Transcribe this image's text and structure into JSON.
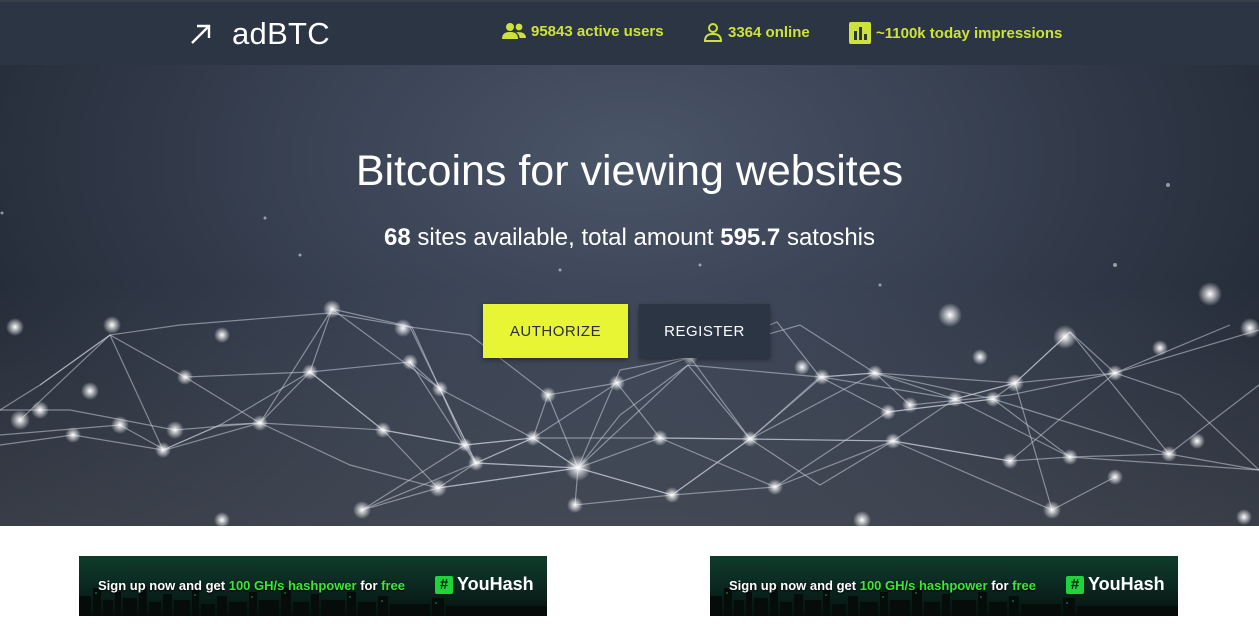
{
  "header": {
    "logo_text": "adBTC",
    "stats": {
      "active_users": "95843 active users",
      "online": "3364 online",
      "impressions": "~1100k today impressions"
    }
  },
  "hero": {
    "title": "Bitcoins for viewing websites",
    "sub_sites_count": "68",
    "sub_middle": " sites available, total amount ",
    "sub_amount": "595.7",
    "sub_unit": " satoshis",
    "authorize_label": "AUTHORIZE",
    "register_label": "REGISTER"
  },
  "banners": [
    {
      "text_part1": "Sign up now and get ",
      "text_highlight1": "100 GH/s hashpower",
      "text_part2": " for ",
      "text_highlight2": "free",
      "brand": "YouHash",
      "brand_symbol": "#"
    },
    {
      "text_part1": "Sign up now and get ",
      "text_highlight1": "100 GH/s hashpower",
      "text_part2": " for ",
      "text_highlight2": "free",
      "brand": "YouHash",
      "brand_symbol": "#"
    }
  ],
  "colors": {
    "header_bg": "#2c3544",
    "accent_yellow": "#e8f534",
    "stat_text": "#cde23a",
    "banner_green": "#3ee63a"
  },
  "icons": {
    "logo": "arrow-up-right-icon",
    "users": "users-group-icon",
    "online": "person-icon",
    "impressions": "bar-chart-icon"
  }
}
